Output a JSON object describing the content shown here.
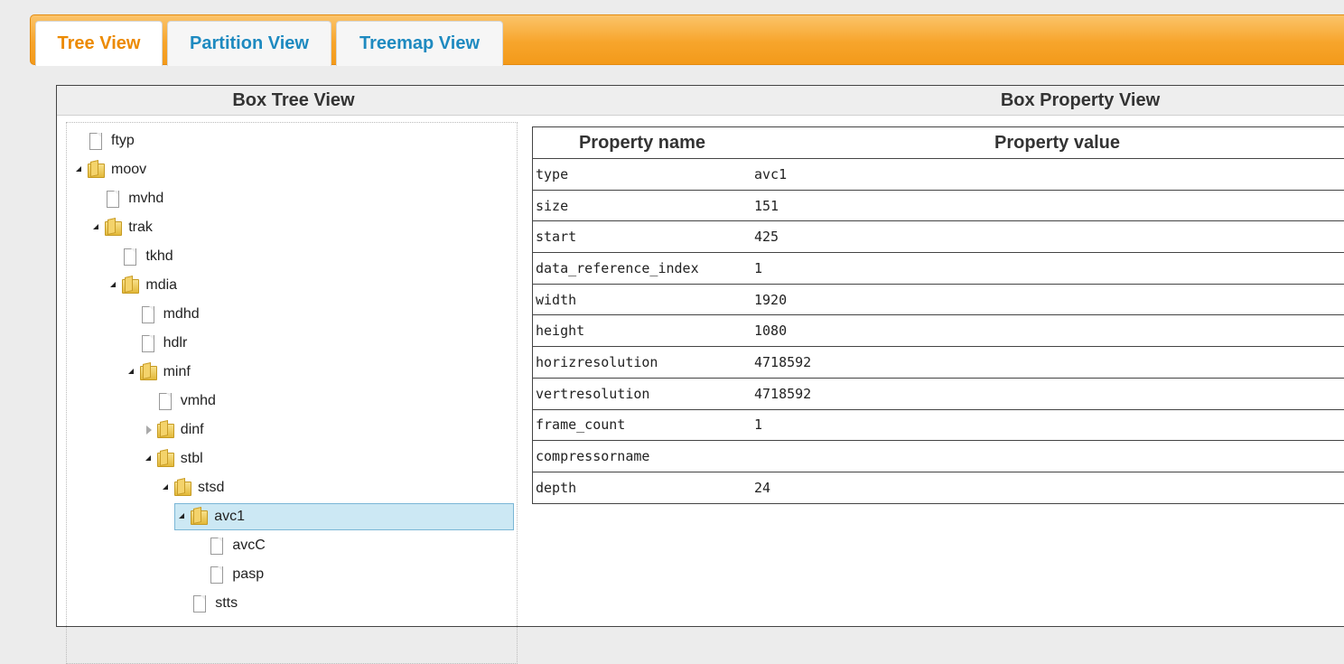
{
  "tabs": [
    {
      "label": "Tree View",
      "active": true
    },
    {
      "label": "Partition View",
      "active": false
    },
    {
      "label": "Treemap View",
      "active": false
    }
  ],
  "panel": {
    "tree_title": "Box Tree View",
    "property_title": "Box Property View"
  },
  "tree": [
    {
      "label": "ftyp",
      "kind": "file",
      "level": 0,
      "toggle": "none"
    },
    {
      "label": "moov",
      "kind": "folder",
      "level": 0,
      "toggle": "open"
    },
    {
      "label": "mvhd",
      "kind": "file",
      "level": 1,
      "toggle": "none"
    },
    {
      "label": "trak",
      "kind": "folder",
      "level": 1,
      "toggle": "open"
    },
    {
      "label": "tkhd",
      "kind": "file",
      "level": 2,
      "toggle": "none"
    },
    {
      "label": "mdia",
      "kind": "folder",
      "level": 2,
      "toggle": "open"
    },
    {
      "label": "mdhd",
      "kind": "file",
      "level": 3,
      "toggle": "none"
    },
    {
      "label": "hdlr",
      "kind": "file",
      "level": 3,
      "toggle": "none"
    },
    {
      "label": "minf",
      "kind": "folder",
      "level": 3,
      "toggle": "open"
    },
    {
      "label": "vmhd",
      "kind": "file",
      "level": 4,
      "toggle": "none"
    },
    {
      "label": "dinf",
      "kind": "folder",
      "level": 4,
      "toggle": "closed"
    },
    {
      "label": "stbl",
      "kind": "folder",
      "level": 4,
      "toggle": "open"
    },
    {
      "label": "stsd",
      "kind": "folder",
      "level": 5,
      "toggle": "open"
    },
    {
      "label": "avc1",
      "kind": "folder",
      "level": 6,
      "toggle": "open",
      "selected": true
    },
    {
      "label": "avcC",
      "kind": "file",
      "level": 7,
      "toggle": "none"
    },
    {
      "label": "pasp",
      "kind": "file",
      "level": 7,
      "toggle": "none"
    },
    {
      "label": "stts",
      "kind": "file",
      "level": 6,
      "toggle": "none"
    }
  ],
  "properties": {
    "header_name": "Property name",
    "header_value": "Property value",
    "rows": [
      {
        "name": "type",
        "value": "avc1"
      },
      {
        "name": "size",
        "value": "151"
      },
      {
        "name": "start",
        "value": "425"
      },
      {
        "name": "data_reference_index",
        "value": "1"
      },
      {
        "name": "width",
        "value": "1920"
      },
      {
        "name": "height",
        "value": "1080"
      },
      {
        "name": "horizresolution",
        "value": "4718592"
      },
      {
        "name": "vertresolution",
        "value": "4718592"
      },
      {
        "name": "frame_count",
        "value": "1"
      },
      {
        "name": "compressorname",
        "value": ""
      },
      {
        "name": "depth",
        "value": "24"
      }
    ]
  },
  "colors": {
    "tab_bar": "#f7a52c",
    "active_tab_text": "#ec8a00",
    "inactive_tab_text": "#1e8ac0",
    "selected_row": "#cce8f4"
  }
}
